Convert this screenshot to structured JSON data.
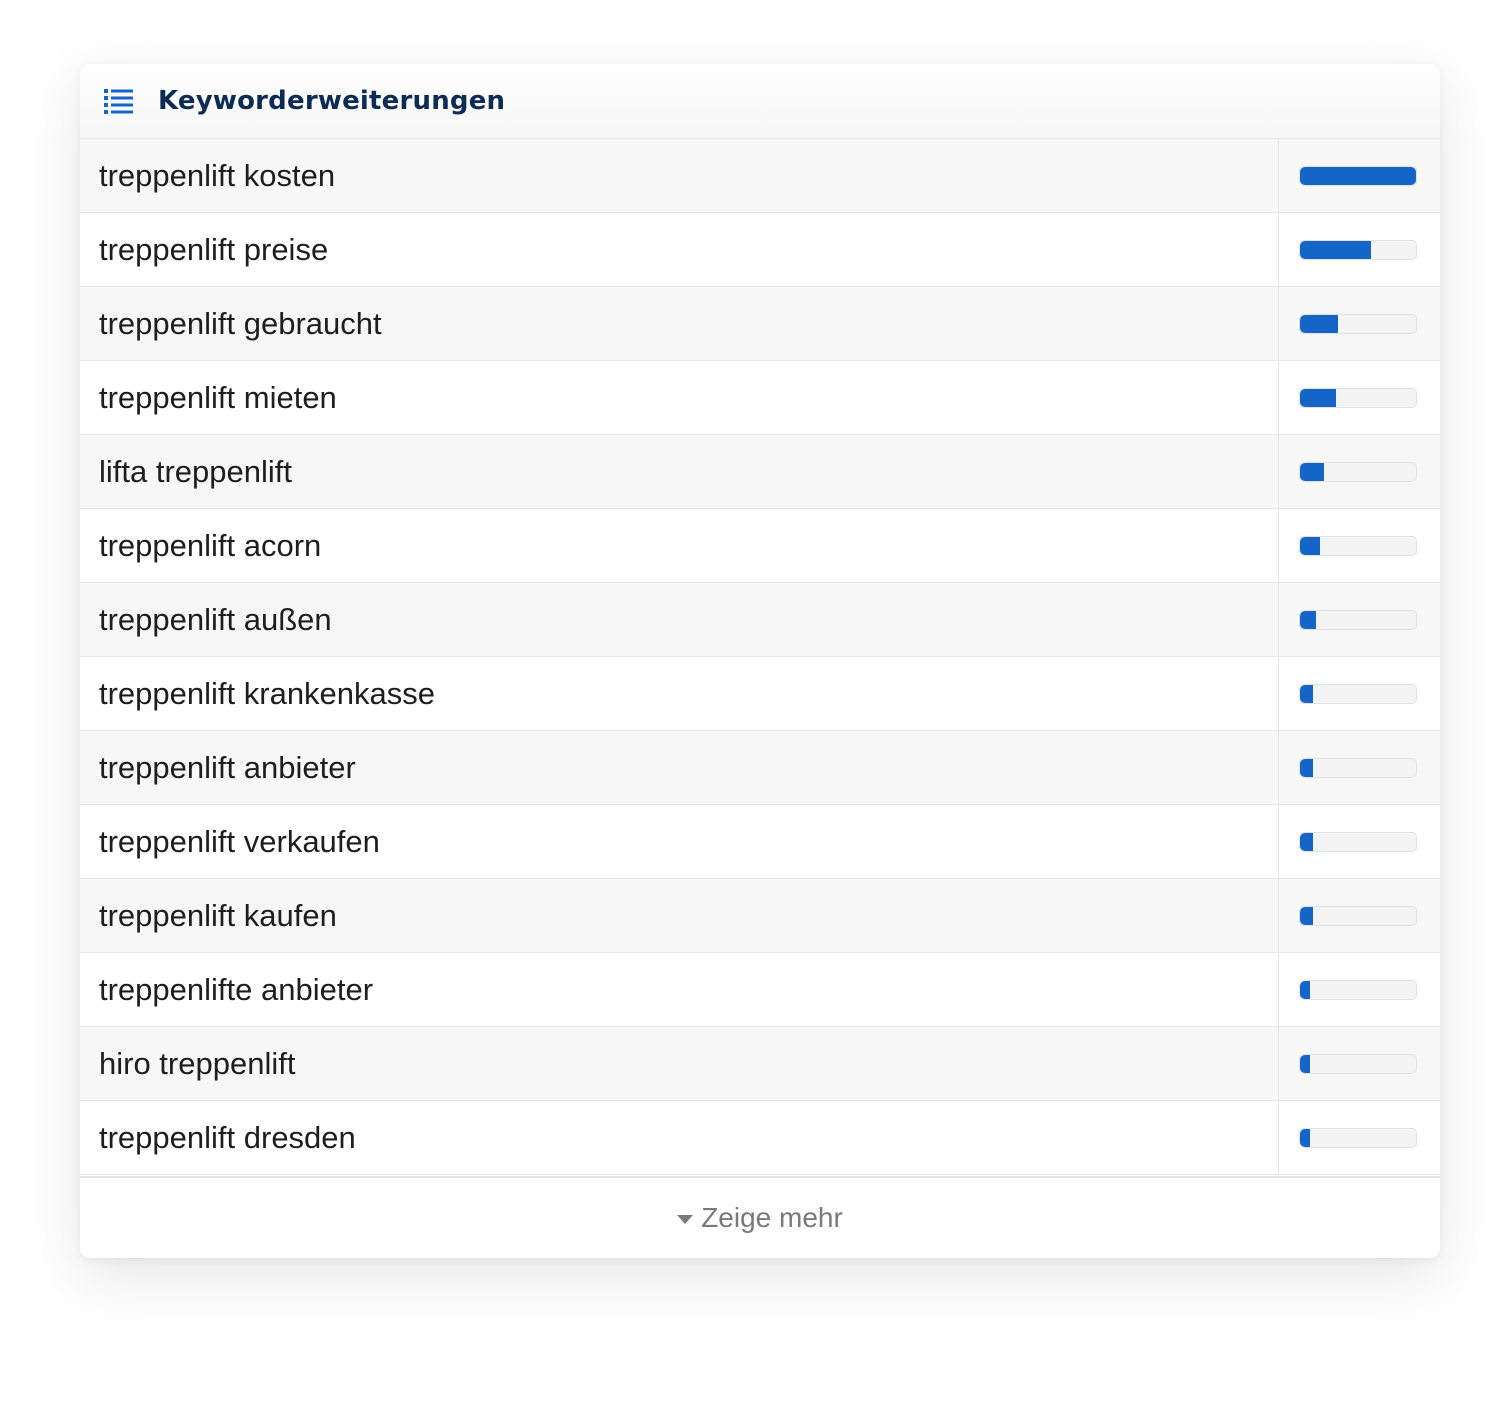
{
  "widget": {
    "title": "Keyworderweiterungen",
    "icon": "list-icon",
    "accent_color": "#1565c8",
    "title_color": "#0d2c54"
  },
  "keywords": [
    {
      "label": "treppenlift kosten",
      "relative_volume": 1.0
    },
    {
      "label": "treppenlift preise",
      "relative_volume": 0.61
    },
    {
      "label": "treppenlift gebraucht",
      "relative_volume": 0.33
    },
    {
      "label": "treppenlift mieten",
      "relative_volume": 0.31
    },
    {
      "label": "lifta treppenlift",
      "relative_volume": 0.21
    },
    {
      "label": "treppenlift acorn",
      "relative_volume": 0.17
    },
    {
      "label": "treppenlift außen",
      "relative_volume": 0.14
    },
    {
      "label": "treppenlift krankenkasse",
      "relative_volume": 0.11
    },
    {
      "label": "treppenlift anbieter",
      "relative_volume": 0.11
    },
    {
      "label": "treppenlift verkaufen",
      "relative_volume": 0.11
    },
    {
      "label": "treppenlift kaufen",
      "relative_volume": 0.11
    },
    {
      "label": "treppenlifte anbieter",
      "relative_volume": 0.09
    },
    {
      "label": "hiro treppenlift",
      "relative_volume": 0.09
    },
    {
      "label": "treppenlift dresden",
      "relative_volume": 0.09
    }
  ],
  "footer": {
    "show_more_label": "Zeige mehr",
    "icon": "caret-down-icon"
  }
}
